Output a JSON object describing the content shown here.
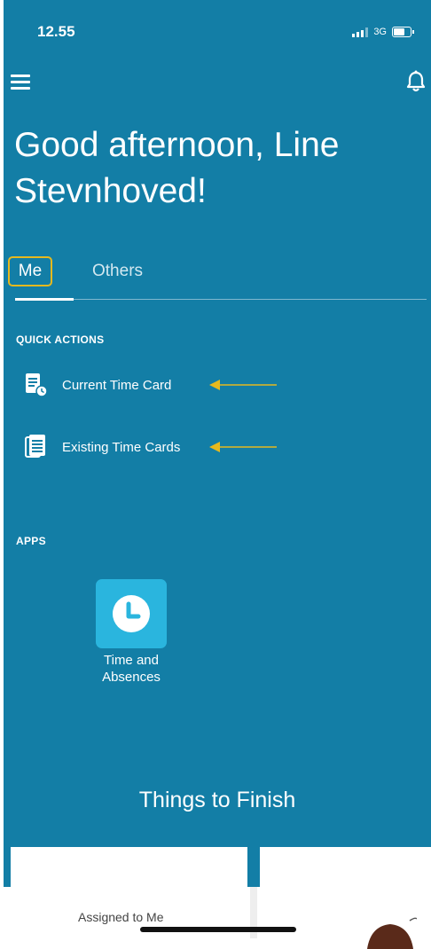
{
  "status_bar": {
    "time": "12.55",
    "network": "3G",
    "icons": [
      "signal-icon",
      "battery-icon"
    ]
  },
  "header": {
    "menu_icon": "hamburger-menu-icon",
    "notification_icon": "bell-icon",
    "greeting": "Good afternoon, Line Stevnhoved!"
  },
  "tabs": [
    {
      "label": "Me",
      "selected": true
    },
    {
      "label": "Others",
      "selected": false
    }
  ],
  "quick_actions": {
    "heading": "QUICK ACTIONS",
    "items": [
      {
        "label": "Current Time Card",
        "icon": "time-card-clock-icon"
      },
      {
        "label": "Existing Time Cards",
        "icon": "document-list-icon"
      }
    ],
    "annotation_color": "#e6b91e"
  },
  "apps": {
    "heading": "APPS",
    "items": [
      {
        "label": "Time and Absences",
        "icon": "clock-icon"
      }
    ]
  },
  "things_to_finish": {
    "title": "Things to Finish",
    "cards": [
      {
        "label": "Assigned to Me"
      }
    ]
  },
  "colors": {
    "background": "#137ea6",
    "accent_tile": "#2ab5de",
    "highlight": "#e6b91e"
  }
}
